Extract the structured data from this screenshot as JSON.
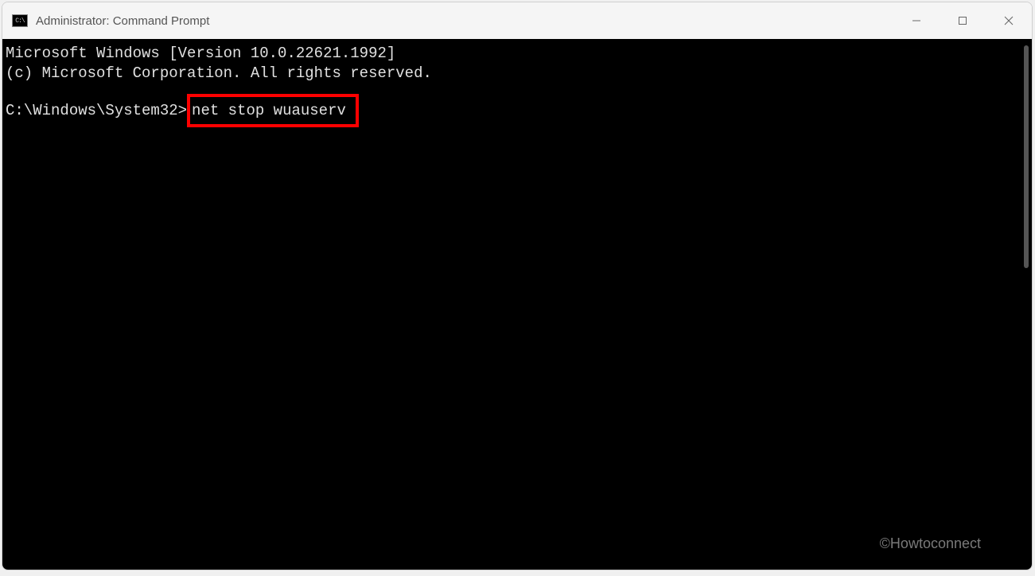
{
  "window": {
    "title": "Administrator: Command Prompt"
  },
  "console": {
    "line1": "Microsoft Windows [Version 10.0.22621.1992]",
    "line2": "(c) Microsoft Corporation. All rights reserved.",
    "prompt_path": "C:\\Windows\\System32>",
    "command": "net stop wuauserv"
  },
  "watermark": "©Howtoconnect"
}
